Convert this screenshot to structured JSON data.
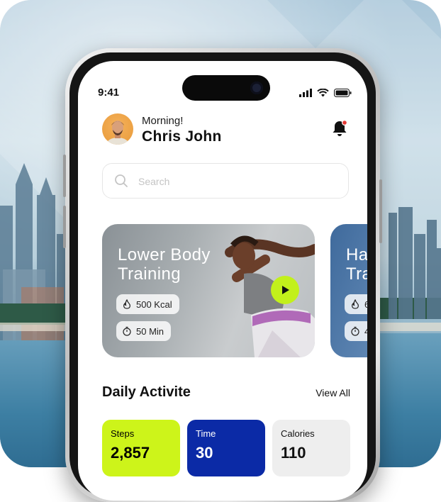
{
  "status_bar": {
    "time": "9:41"
  },
  "header": {
    "greeting": "Morning!",
    "user_name": "Chris John"
  },
  "search": {
    "placeholder": "Search"
  },
  "workouts": [
    {
      "title": "Lower Body Training",
      "calories": "500 Kcal",
      "duration": "50 Min"
    },
    {
      "title": "Ha Tra",
      "calories": "6",
      "duration": "4"
    }
  ],
  "daily_activity": {
    "title": "Daily Activite",
    "view_all": "View All",
    "stats": [
      {
        "label": "Steps",
        "value": "2,857"
      },
      {
        "label": "Time",
        "value": "30"
      },
      {
        "label": "Calories",
        "value": "110"
      }
    ]
  },
  "colors": {
    "accent_lime": "#cdf41a",
    "accent_blue": "#0b2aa6",
    "play_button": "#c2f01b",
    "notification_dot": "#e53935"
  },
  "icons": [
    "notification-bell-icon",
    "search-icon",
    "flame-icon",
    "stopwatch-icon",
    "play-icon",
    "signal-icon",
    "wifi-icon",
    "battery-icon"
  ]
}
